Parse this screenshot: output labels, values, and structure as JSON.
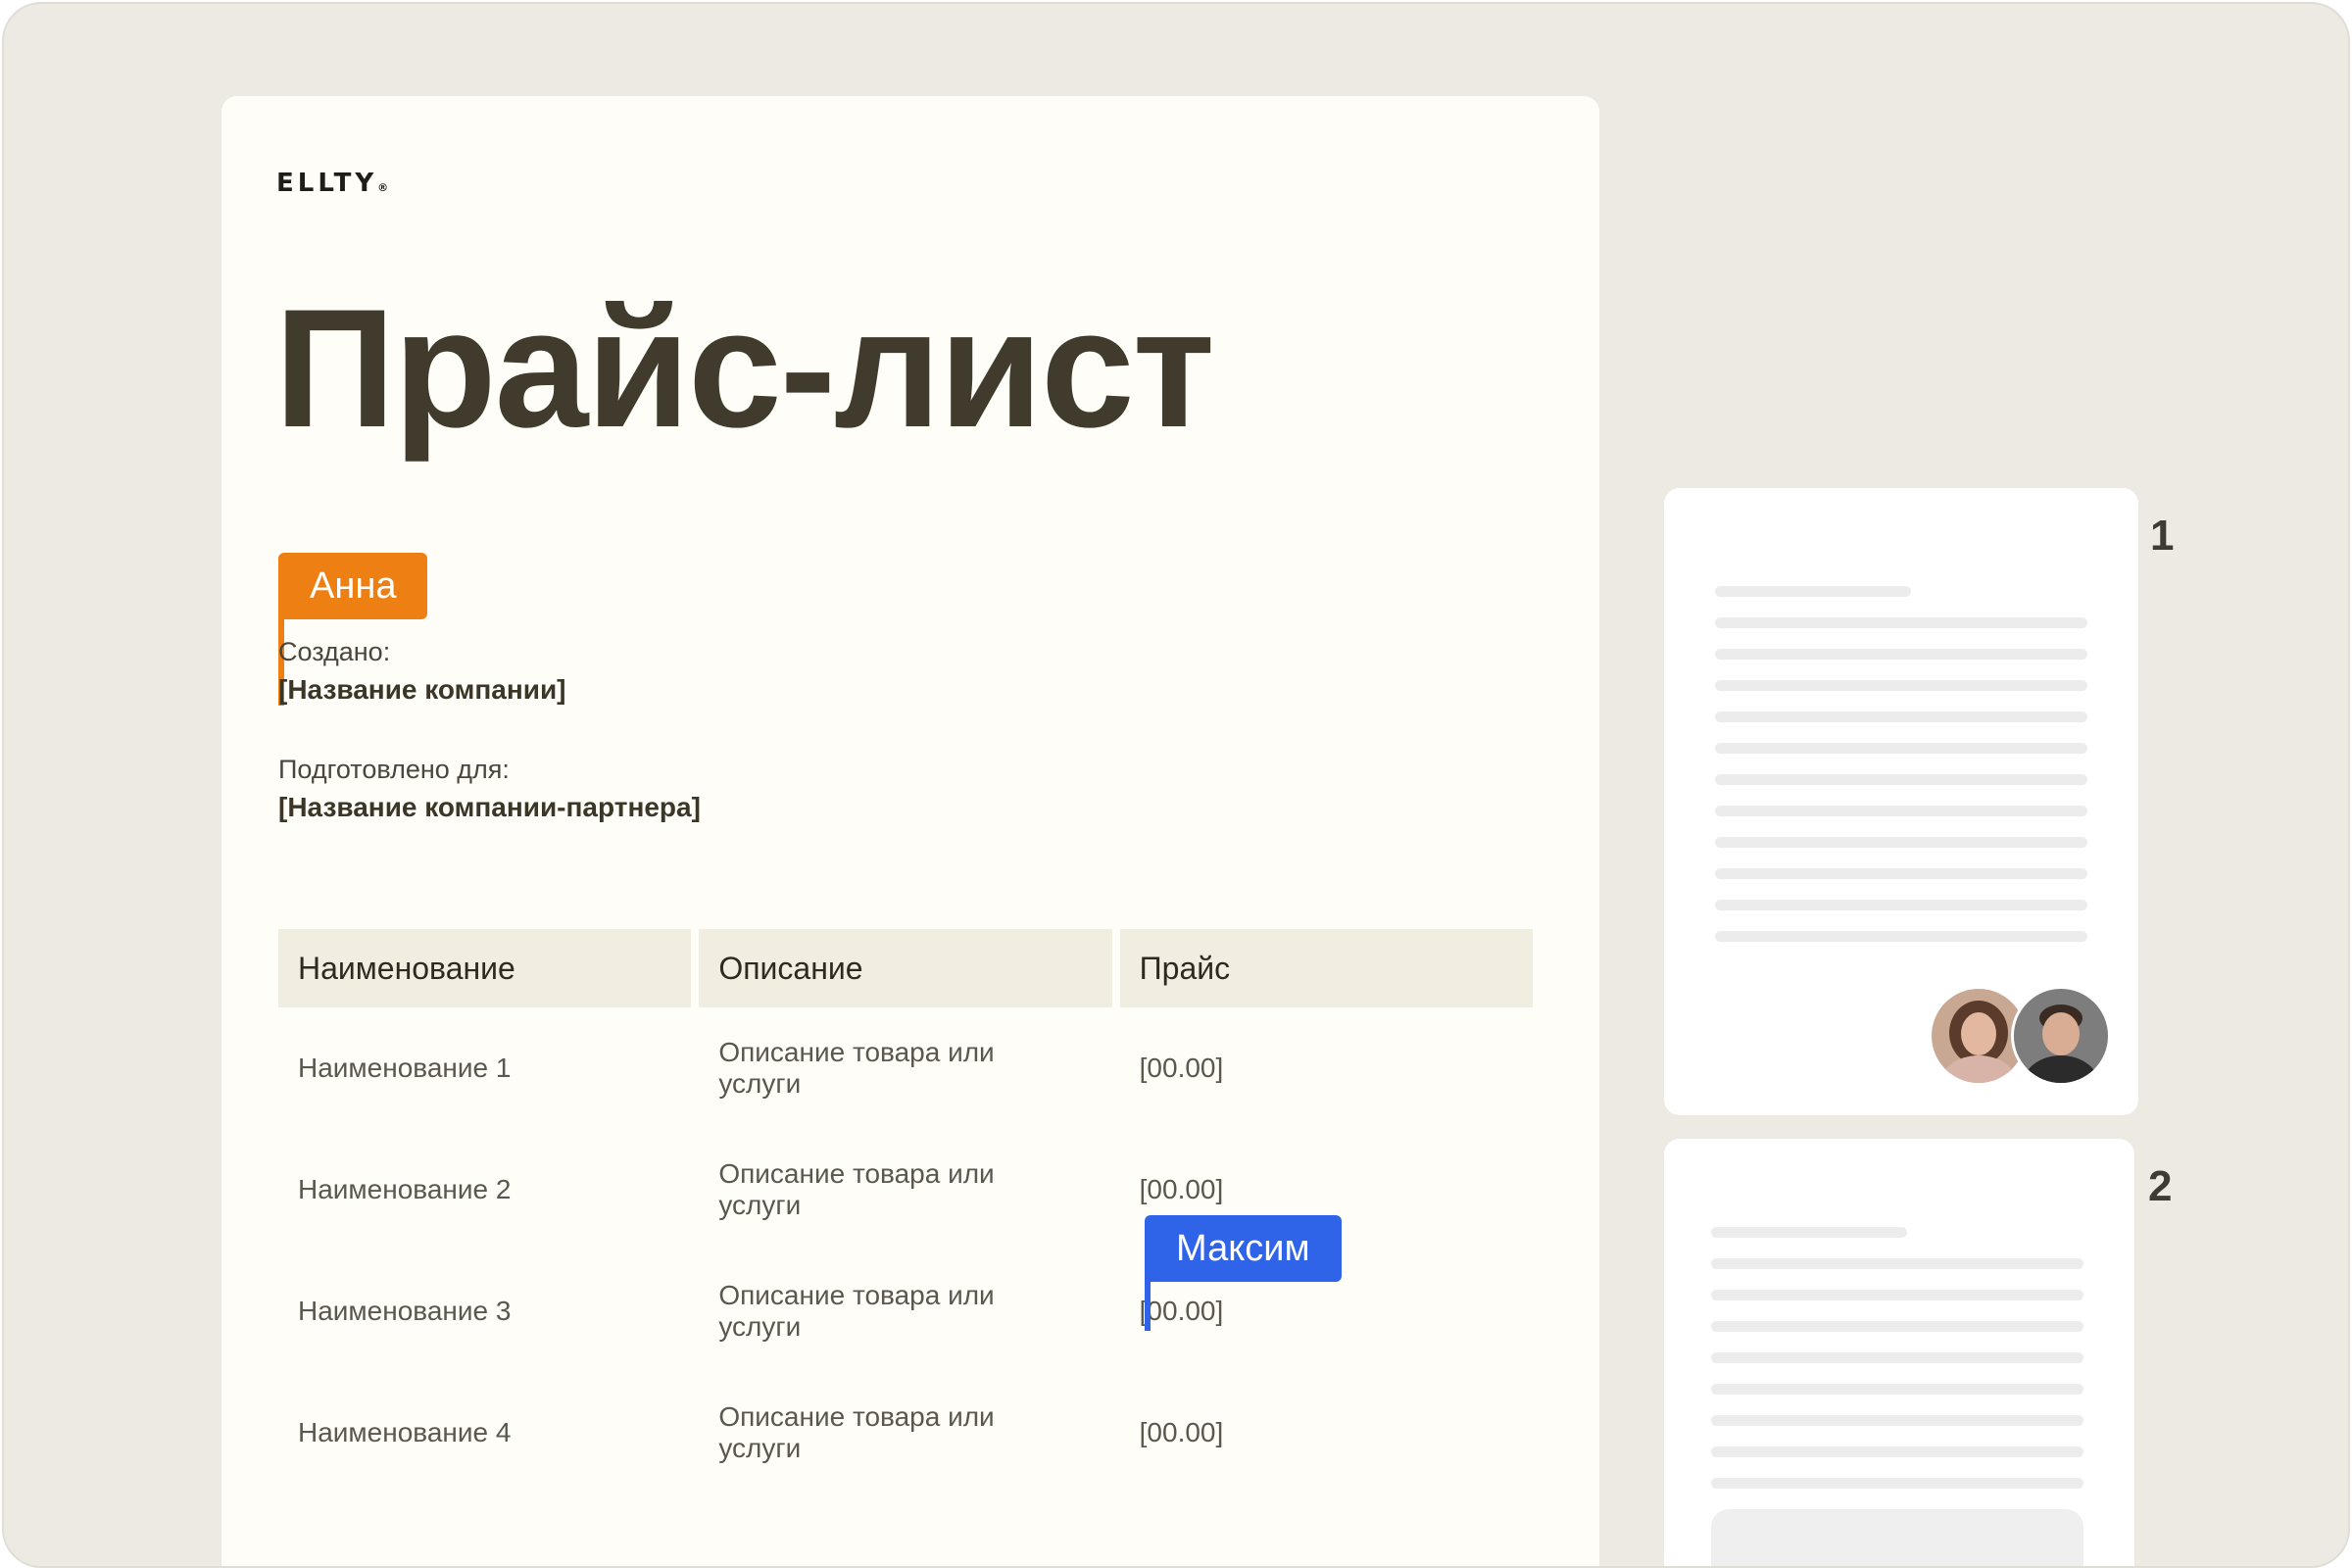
{
  "document": {
    "logo": "ELLTY",
    "logo_mark": "®",
    "title": "Прайс-лист",
    "created_label": "Создано:",
    "created_value": "[Название компании]",
    "prepared_label": "Подготовлено для:",
    "prepared_value": "[Название компании-партнера]",
    "table": {
      "headers": [
        "Наименование",
        "Описание",
        "Прайс"
      ],
      "rows": [
        [
          "Наименование 1",
          "Описание товара или услуги",
          "[00.00]"
        ],
        [
          "Наименование 2",
          "Описание товара или услуги",
          "[00.00]"
        ],
        [
          "Наименование 3",
          "Описание товара или услуги",
          "[00.00]"
        ],
        [
          "Наименование 4",
          "Описание товара или услуги",
          "[00.00]"
        ]
      ]
    }
  },
  "collaborators": [
    {
      "name": "Анна",
      "color": "#ee7f12"
    },
    {
      "name": "Максим",
      "color": "#2f64e8"
    }
  ],
  "thumbnails": [
    {
      "number": "1"
    },
    {
      "number": "2"
    }
  ]
}
